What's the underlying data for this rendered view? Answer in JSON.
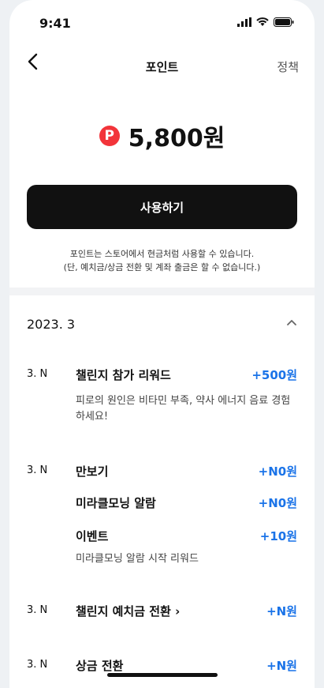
{
  "status": {
    "time": "9:41"
  },
  "nav": {
    "back_icon": "chevron-left-icon",
    "title": "포인트",
    "policy": "정책"
  },
  "points": {
    "badge": "P",
    "amount": "5,800원"
  },
  "use_button": "사용하기",
  "note": {
    "line1": "포인트는 스토어에서 현금처럼 사용할 수 있습니다.",
    "line2": "(단, 예치금/상금 전환 및 계좌 출금은 할 수 없습니다.)"
  },
  "section": {
    "month": "2023. 3",
    "collapse_icon": "chevron-up-icon"
  },
  "entries": [
    {
      "date": "3. N",
      "label": "챌린지 참가 리워드",
      "value": "+500원",
      "desc": "피로의 원인은 비타민 부족, 약사 에너지 음료 경험하세요!"
    },
    {
      "date": "3. N",
      "label": "만보기",
      "value": "+N0원"
    },
    {
      "label": "미라클모닝 알람",
      "value": "+N0원"
    },
    {
      "label": "이벤트",
      "value": "+10원",
      "desc": "미라클모닝 알람 시작 리워드"
    },
    {
      "date": "3. N",
      "label": "챌린지 예치금 전환  ›",
      "value": "+N원"
    },
    {
      "date": "3. N",
      "label": "상금 전환",
      "value": "+N원"
    }
  ],
  "colors": {
    "accent": "#1a73e8",
    "badge": "#f2343a",
    "button": "#111111"
  }
}
